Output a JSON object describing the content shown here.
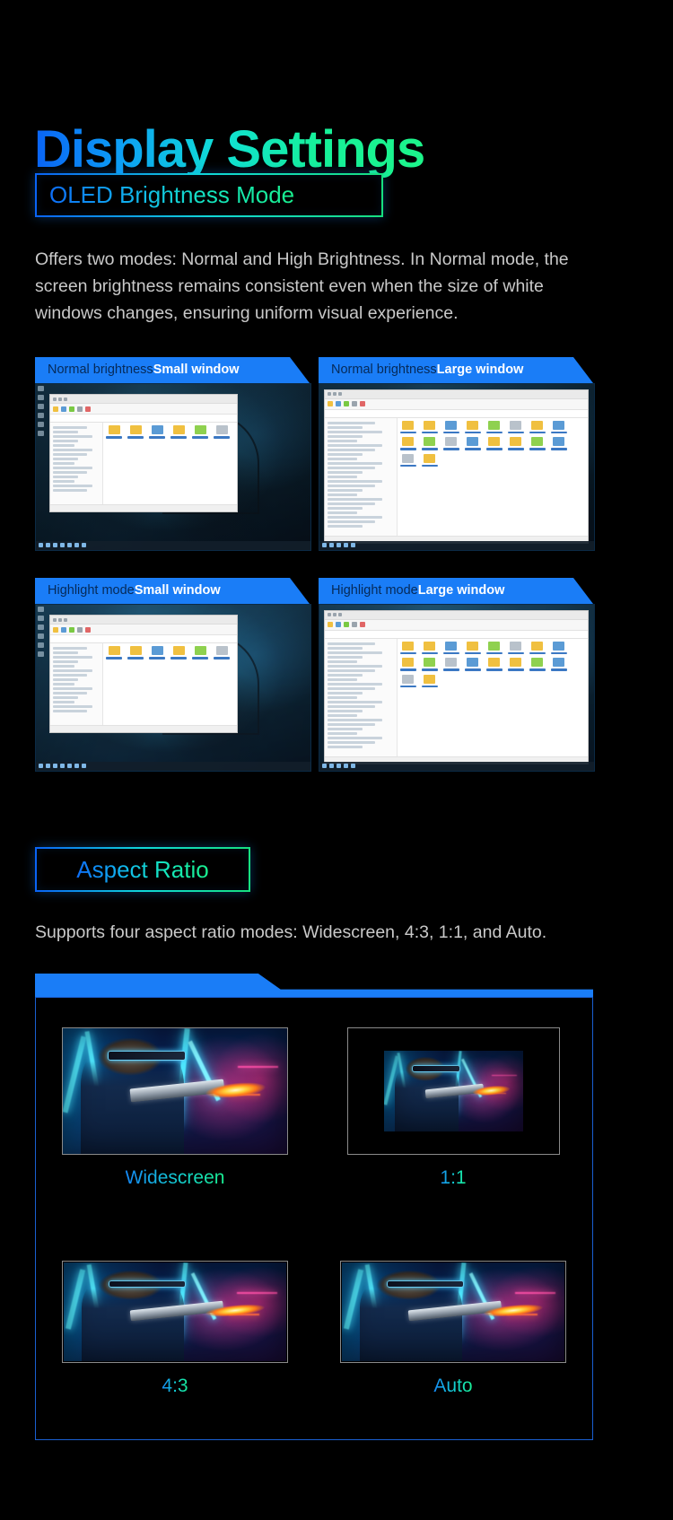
{
  "page": {
    "title": "Display Settings",
    "background_color": "#000000",
    "accent_blue": "#1a7df7",
    "accent_green": "#19ef92"
  },
  "sections": [
    {
      "id": "oled",
      "chip_label": "OLED Brightness Mode",
      "description": "Offers two modes: Normal and High Brightness. In Normal mode, the screen brightness remains consistent even when the size of white windows changes, ensuring uniform visual experience.",
      "cards": [
        {
          "mode": "Normal brightness",
          "window": "Small window"
        },
        {
          "mode": "Normal brightness",
          "window": "Large window"
        },
        {
          "mode": "Highlight mode",
          "window": "Small window"
        },
        {
          "mode": "Highlight mode",
          "window": "Large window"
        }
      ]
    },
    {
      "id": "aspect",
      "chip_label": "Aspect Ratio",
      "description": "Supports four aspect ratio modes: Widescreen, 4:3, 1:1, and Auto.",
      "ratios": [
        {
          "label": "Widescreen"
        },
        {
          "label": "1:1"
        },
        {
          "label": "4:3"
        },
        {
          "label": "Auto"
        }
      ]
    }
  ]
}
